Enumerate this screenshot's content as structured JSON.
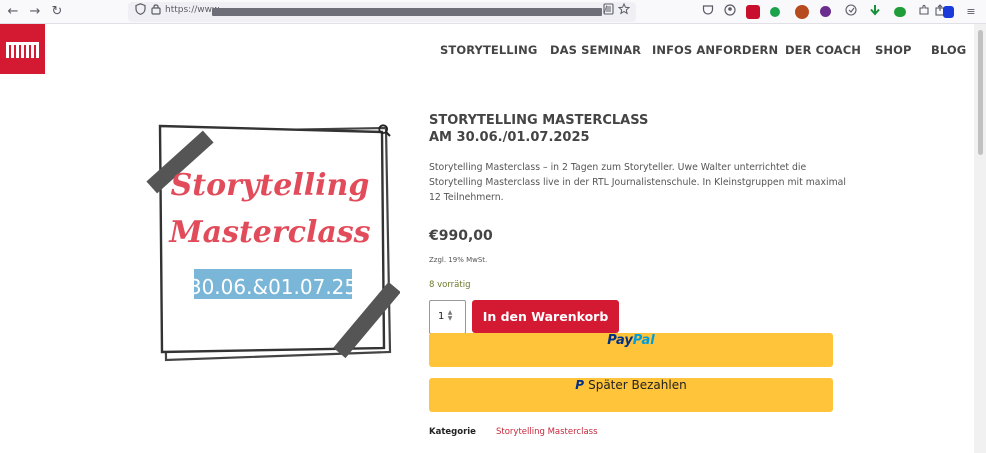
{
  "browser": {
    "back_icon": "←",
    "forward_icon": "→",
    "reload_icon": "↻",
    "shield_icon": "shield-icon",
    "lock_icon": "lock-icon",
    "url_prefix": "https://www.",
    "url_suffix": "/",
    "reader_icon": "reader-icon",
    "bookmark_icon": "star-icon",
    "extension_colors": [
      "#c8102e",
      "#1aa34a",
      "#b84a1f",
      "#6b2d8e",
      "#1f9d3a",
      "#1a73e8"
    ],
    "menu_icon": "≡"
  },
  "site": {
    "brand_color": "#d41a33",
    "nav": [
      "STORYTELLING",
      "DAS SEMINAR",
      "INFOS ANFORDERN",
      "DER COACH",
      "SHOP",
      "BLOG"
    ]
  },
  "product": {
    "image": {
      "title_line1": "Storytelling",
      "title_line2": "Masterclass",
      "date_banner": "30.06.&01.07.25",
      "title_color": "#e14b5a",
      "banner_color": "#7ab6d8"
    },
    "title_line1": "STORYTELLING MASTERCLASS",
    "title_line2": "AM 30.06./01.07.2025",
    "description": "Storytelling Masterclass – in 2 Tagen zum Storyteller. Uwe Walter unterrichtet die Storytelling Masterclass live in der RTL Journalistenschule. In Kleinstgruppen mit maximal 12 Teilnehmern.",
    "price": "€990,00",
    "tax_note": "Zzgl. 19% MwSt.",
    "stock": "8 vorrätig",
    "quantity": "1",
    "add_to_cart": "In den Warenkorb",
    "paypal_part1": "Pay",
    "paypal_part2": "Pal",
    "pay_later_icon": "P",
    "pay_later": "Später Bezahlen",
    "category_label": "Kategorie",
    "category_value": "Storytelling Masterclass"
  }
}
